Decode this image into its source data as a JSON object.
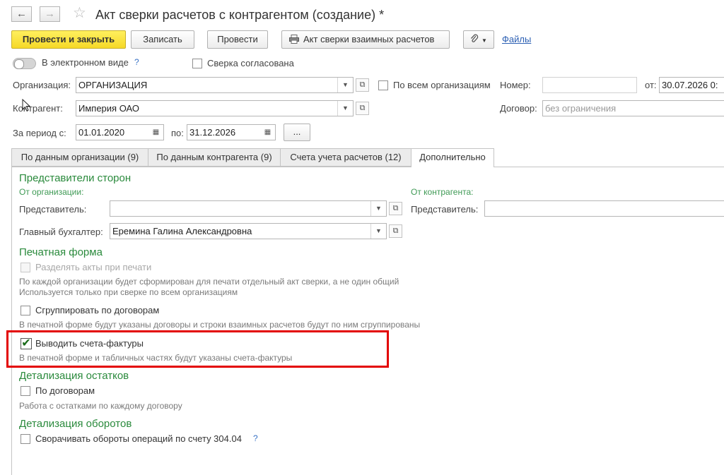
{
  "window": {
    "title": "Акт сверки расчетов с контрагентом (создание) *",
    "back_icon": "←",
    "forward_icon": "→",
    "star_icon": "☆"
  },
  "toolbar": {
    "post_close": "Провести и закрыть",
    "save": "Записать",
    "post": "Провести",
    "print_label": "Акт сверки взаимных расчетов",
    "files": "Файлы"
  },
  "header": {
    "electronic_label": "В электронном виде",
    "help_mark": "?",
    "agreed_label": "Сверка согласована",
    "org_label": "Организация:",
    "org_value": "ОРГАНИЗАЦИЯ",
    "all_orgs_label": "По всем организациям",
    "number_label": "Номер:",
    "number_value": "",
    "from_label": "от:",
    "date_value": "30.07.2026  0:",
    "counterparty_label": "Контрагент:",
    "counterparty_value": "Империя ОАО",
    "contract_label": "Договор:",
    "contract_placeholder": "без ограничения",
    "period_label": "За период с:",
    "period_from": "01.01.2020",
    "period_to_label": "по:",
    "period_to": "31.12.2026",
    "ellipsis": "..."
  },
  "tabs": [
    {
      "label": "По данным организации (9)"
    },
    {
      "label": "По данным контрагента (9)"
    },
    {
      "label": "Счета учета расчетов (12)"
    },
    {
      "label": "Дополнительно"
    }
  ],
  "reps": {
    "section": "Представители сторон",
    "from_org": "От организации:",
    "from_cp": "От контрагента:",
    "rep_label": "Представитель:",
    "rep_value": "",
    "cp_rep_label": "Представитель:",
    "chief_label": "Главный бухгалтер:",
    "chief_value": "Еремина Галина Александровна"
  },
  "print_form": {
    "section": "Печатная форма",
    "split_label": "Разделять акты при печати",
    "split_hint1": "По каждой организации будет сформирован для печати отдельный акт сверки, а не один общий",
    "split_hint2": "Используется только при сверке по всем организациям",
    "group_label": "Сгруппировать по договорам",
    "group_hint": "В печатной форме будут указаны договоры и строки взаимных расчетов будут по ним сгруппированы",
    "invoices_label": "Выводить счета-фактуры",
    "invoices_hint": "В печатной форме и табличных частях будут указаны счета-фактуры"
  },
  "balances": {
    "section": "Детализация остатков",
    "by_contracts_label": "По договорам",
    "by_contracts_hint": "Работа с остатками по каждому договору"
  },
  "turnovers": {
    "section": "Детализация оборотов",
    "collapse_label": "Сворачивать обороты операций по счету 304.04"
  },
  "colors": {
    "highlight": "#e30000",
    "section_green": "#2a8a3c",
    "primary_button": "#f6d927"
  }
}
